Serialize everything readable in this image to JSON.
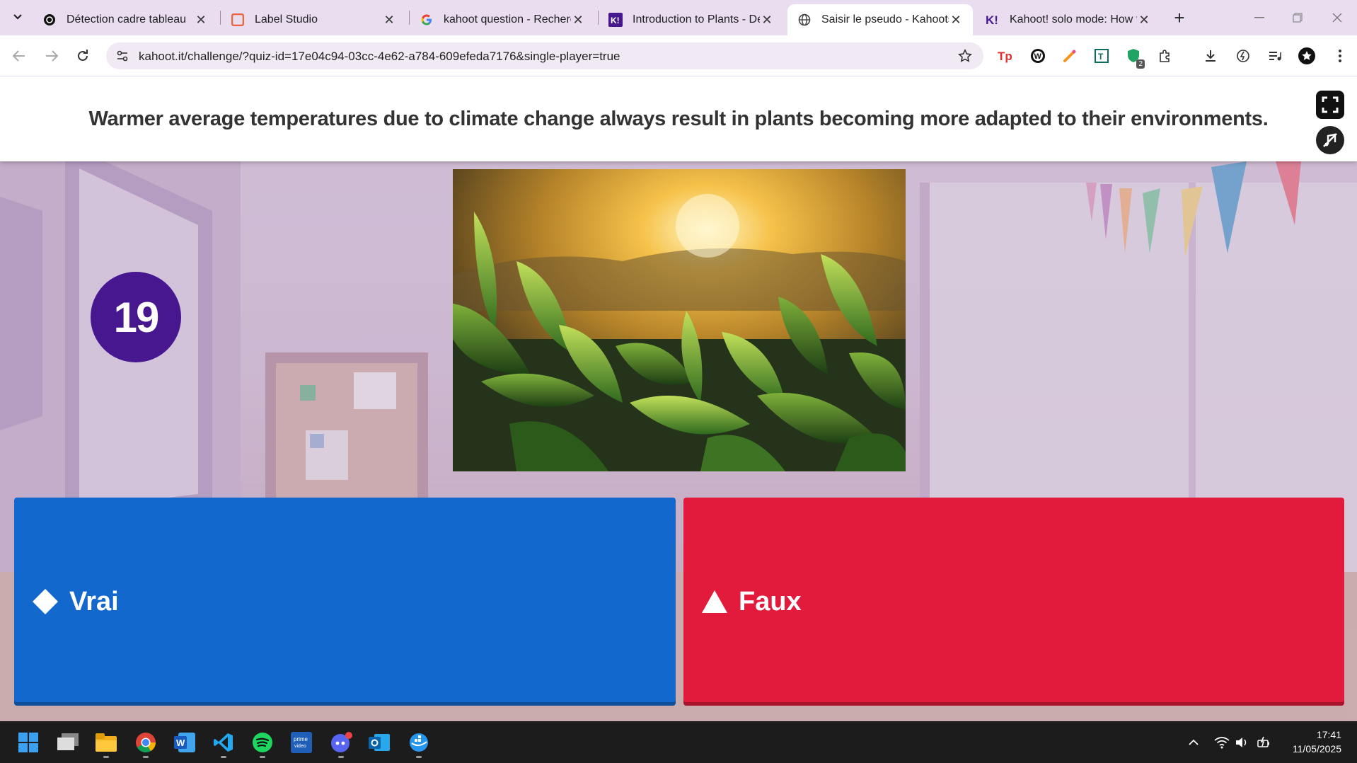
{
  "browser": {
    "tabs": [
      {
        "title": "Détection cadre tableau",
        "icon": "chatgpt-icon"
      },
      {
        "title": "Label Studio",
        "icon": "label-studio-icon"
      },
      {
        "title": "kahoot question - Recherc",
        "icon": "google-icon"
      },
      {
        "title": "Introduction to Plants - Dé",
        "icon": "kahoot-icon"
      },
      {
        "title": "Saisir le pseudo - Kahoots",
        "icon": "globe-icon",
        "active": true
      },
      {
        "title": "Kahoot! solo mode: How to",
        "icon": "kahoot-icon"
      }
    ],
    "url": "kahoot.it/challenge/?quiz-id=17e04c94-03cc-4e62-a784-609efeda7176&single-player=true",
    "extension_badge": "2"
  },
  "quiz": {
    "question": "Warmer average temperatures due to climate change always result in plants becoming more adapted to their environments.",
    "timer": "19",
    "image_subject": "tea-plant-leaves-at-sunset",
    "answers": [
      {
        "label": "Vrai",
        "shape": "diamond",
        "color": "#1368ce"
      },
      {
        "label": "Faux",
        "shape": "triangle",
        "color": "#e21b3c"
      }
    ]
  },
  "taskbar": {
    "apps": [
      "windows-start-icon",
      "task-view-icon",
      "file-explorer-icon",
      "chrome-icon",
      "word-icon",
      "vscode-icon",
      "spotify-icon",
      "prime-video-icon",
      "discord-icon",
      "outlook-icon",
      "docker-icon"
    ],
    "time": "17:41",
    "date": "11/05/2025"
  },
  "colors": {
    "kahoot_purple": "#46178f",
    "blue_answer": "#1368ce",
    "red_answer": "#e21b3c"
  }
}
